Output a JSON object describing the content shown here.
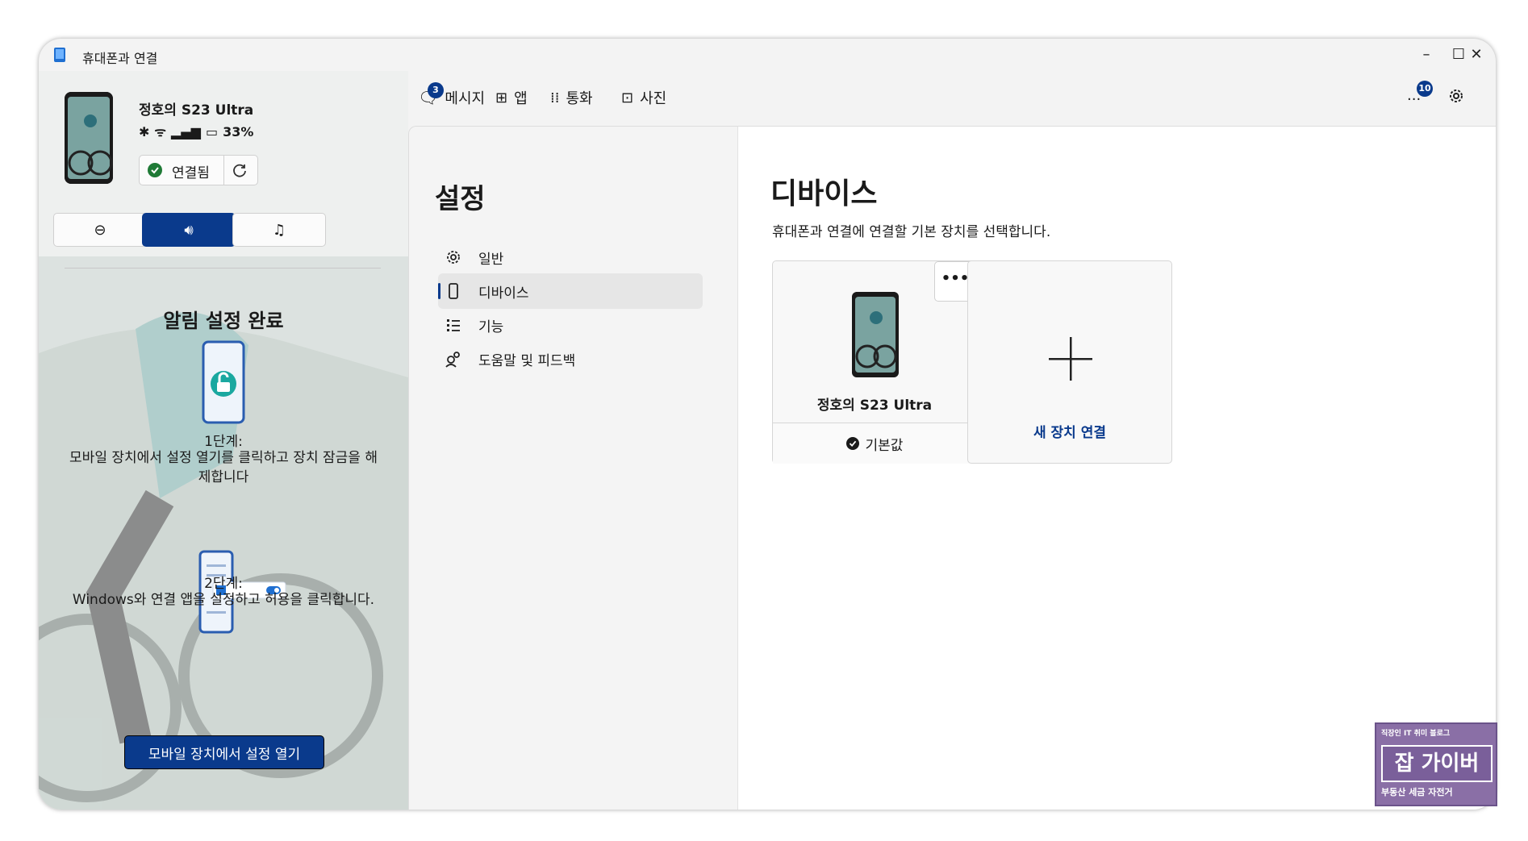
{
  "window": {
    "title": "휴대폰과 연결",
    "controls": [
      "–",
      "☐",
      "✕"
    ]
  },
  "sidebar": {
    "device_name": "정호의 S23 Ultra",
    "battery": "33%",
    "connected_label": "연결됨",
    "notification_title": "알림 설정 완료",
    "step1_label": "1단계:",
    "step1_text": "모바일 장치에서 설정 열기를 클릭하고 장치 잠금을 해제합니다",
    "step2_label": "2단계:",
    "step2_text": "Windows와 연결 앱을 설정하고 허용을 클릭합니다.",
    "open_settings_button": "모바일 장치에서 설정 열기",
    "active_mode": "volume"
  },
  "topnav": {
    "tabs": [
      {
        "label": "메시지",
        "badge": "3"
      },
      {
        "label": "앱"
      },
      {
        "label": "통화"
      },
      {
        "label": "사진"
      }
    ],
    "more_label": "...",
    "more_badge": "10"
  },
  "settings": {
    "title": "설정",
    "items": [
      {
        "label": "일반",
        "icon": "gear-icon"
      },
      {
        "label": "디바이스",
        "icon": "phone-icon",
        "selected": true
      },
      {
        "label": "기능",
        "icon": "list-icon"
      },
      {
        "label": "도움말 및 피드백",
        "icon": "people-icon"
      }
    ]
  },
  "content": {
    "title": "디바이스",
    "subtitle": "휴대폰과 연결에 연결할 기본 장치를 선택합니다.",
    "device_card": {
      "name": "정호의 S23 Ultra",
      "more": "•••",
      "status": "기본값"
    },
    "add_card": {
      "label": "새 장치 연결"
    }
  },
  "watermark": {
    "top": "직장인 IT 취미 블로그",
    "main": "잡 가이버",
    "bottom": "부동산 세금 자전거"
  },
  "colors": {
    "accent": "#0a3a8c",
    "success": "#1f7a36"
  }
}
